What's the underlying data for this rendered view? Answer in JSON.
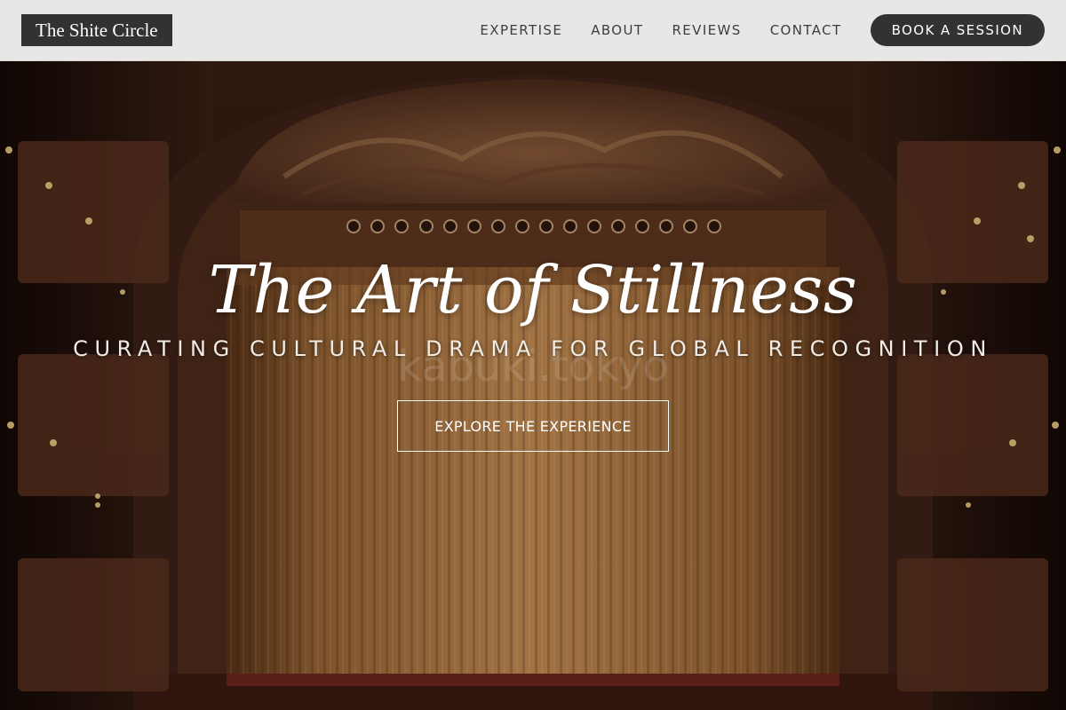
{
  "header": {
    "logo": "The Shite Circle",
    "nav": [
      {
        "label": "EXPERTISE"
      },
      {
        "label": "ABOUT"
      },
      {
        "label": "REVIEWS"
      },
      {
        "label": "CONTACT"
      }
    ],
    "cta_label": "BOOK A SESSION"
  },
  "hero": {
    "title": "The Art of Stillness",
    "subtitle": "CURATING CULTURAL DRAMA FOR GLOBAL RECOGNITION",
    "button_label": "EXPLORE THE EXPERIENCE",
    "watermark": "kabuki.tokyo"
  },
  "colors": {
    "header_bg": "#f0eeec",
    "dark": "#333131",
    "curtain": "#b07a45",
    "proscenium": "#3a1f14"
  }
}
